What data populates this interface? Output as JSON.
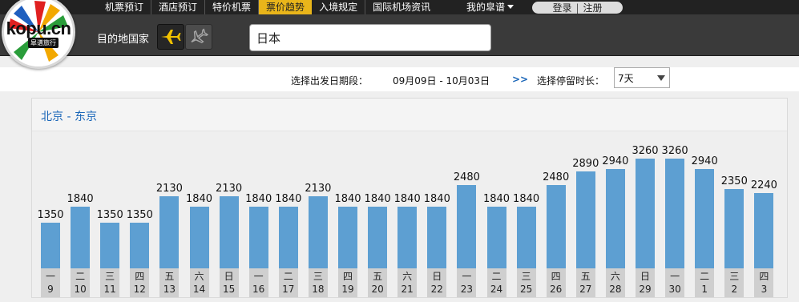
{
  "nav": {
    "items": [
      "机票预订",
      "酒店预订",
      "特价机票",
      "票价趋势",
      "入境规定",
      "国际机场资讯"
    ],
    "active": "票价趋势",
    "mine": "我的皐谱",
    "login": "登录",
    "register": "注册"
  },
  "logo": {
    "text": "kopu.cn",
    "sub": "皐谱旅行"
  },
  "search": {
    "dest_label": "目的地国家",
    "country_value": "日本",
    "plane_icons": [
      "international-flight-icon",
      "domestic-flight-icon"
    ]
  },
  "filter": {
    "date_label": "选择出发日期段：",
    "date_range": "09月09日 - 10月03日",
    "arrow": ">>",
    "stay_label": "选择停留时长：",
    "stay_value": "7天"
  },
  "route": {
    "title": "北京 - 东京"
  },
  "colors": {
    "bar": "#5d9fd2",
    "active_tab": "#e9b51a",
    "link": "#1a66b8"
  },
  "chart_data": {
    "type": "bar",
    "title": "北京 - 东京",
    "categories": [
      "9",
      "10",
      "11",
      "12",
      "13",
      "14",
      "15",
      "16",
      "17",
      "18",
      "19",
      "20",
      "21",
      "22",
      "23",
      "24",
      "25",
      "26",
      "27",
      "28",
      "29",
      "30",
      "1",
      "2",
      "3"
    ],
    "weekdays": [
      "一",
      "二",
      "三",
      "四",
      "五",
      "六",
      "日",
      "一",
      "二",
      "三",
      "四",
      "五",
      "六",
      "日",
      "一",
      "二",
      "三",
      "四",
      "五",
      "六",
      "日",
      "一",
      "二",
      "三",
      "四"
    ],
    "values": [
      1350,
      1840,
      1350,
      1350,
      2130,
      1840,
      2130,
      1840,
      1840,
      2130,
      1840,
      1840,
      1840,
      1840,
      2480,
      1840,
      1840,
      2480,
      2890,
      2940,
      3260,
      3260,
      2940,
      2350,
      2240
    ],
    "ylim": [
      0,
      3260
    ]
  }
}
